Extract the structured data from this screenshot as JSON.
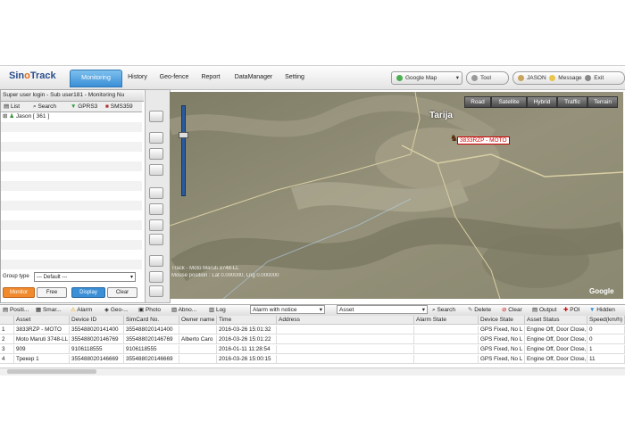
{
  "app": {
    "logo_left": "Sin",
    "logo_mid": "o",
    "logo_right": "Track"
  },
  "nav": {
    "tabs": [
      "Monitoring",
      "History",
      "Geo-fence",
      "Report",
      "DataManager",
      "Setting"
    ],
    "active": "Monitoring"
  },
  "topright": {
    "map_select": "Google Map",
    "tool": "Tool",
    "user": "JASON",
    "message": "Message",
    "exit": "Exit"
  },
  "left": {
    "header": "Super user login - Sub user181 - Monitoring Nu",
    "cmd": "cmd",
    "tabs": {
      "list": "List",
      "search": "Search",
      "gprs": "GPRS3",
      "sms": "SMS359"
    },
    "tree_item": "Jason [ 361 ]",
    "group_label": "Group type",
    "group_value": "--- Default ---",
    "buttons": {
      "monitor": "Monitor",
      "free": "Free",
      "display": "Display",
      "clear": "Clear"
    }
  },
  "map": {
    "types": [
      "Road",
      "Satellite",
      "Hybrid",
      "Traffic",
      "Terrain"
    ],
    "marker_label": "3833RZP - MOTO",
    "city_label": "Tarija",
    "footer_text": "Track - Moto Maruti 3748-LL",
    "footer_text2": "Mouse position : Lat 0.000000, Lng 0.000000",
    "google": "Google"
  },
  "bottom": {
    "tabs": [
      "Positi...",
      "Smar...",
      "Alarm",
      "Geo-...",
      "Photo",
      "Abno...",
      "Log"
    ],
    "alarm_filter": "Alarm with notice",
    "asset_filter": "Asset",
    "actions": {
      "search": "Search",
      "delete": "Delete",
      "clear": "Clear",
      "output": "Output",
      "poi": "POI",
      "hidden": "Hidden"
    }
  },
  "table": {
    "columns": [
      "Asset",
      "Device ID",
      "SimCard No.",
      "Owner name",
      "Time",
      "Address",
      "Alarm State",
      "Device State",
      "Asset Status",
      "Speed(km/h)"
    ],
    "rows": [
      {
        "n": "1",
        "asset": "3833RZP - MOTO",
        "device_id": "355488020141400",
        "sim": "355488020141400",
        "owner": "",
        "time": "2016-03-26 15:01:32",
        "address": "",
        "alarm": "",
        "device_state": "GPS Fixed, No L",
        "asset_status": "Engine Off, Door Close,",
        "speed": "0"
      },
      {
        "n": "2",
        "asset": "Moto Maruti 3748-LL",
        "device_id": "355488020146769",
        "sim": "355488020146769",
        "owner": "Alberto Caro",
        "time": "2016-03-26 15:01:22",
        "address": "",
        "alarm": "",
        "device_state": "GPS Fixed, No L",
        "asset_status": "Engine Off, Door Close,",
        "speed": "0"
      },
      {
        "n": "3",
        "asset": "909",
        "device_id": "9106118555",
        "sim": "9106118555",
        "owner": "",
        "time": "2016-01-11 11:28:54",
        "address": "",
        "alarm": "",
        "device_state": "GPS Fixed, No L",
        "asset_status": "Engine Off, Door Close,",
        "speed": "1"
      },
      {
        "n": "4",
        "asset": "Трекер 1",
        "device_id": "355488020146669",
        "sim": "355488020146669",
        "owner": "",
        "time": "2016-03-26 15:00:15",
        "address": "",
        "alarm": "",
        "device_state": "GPS Fixed, No L",
        "asset_status": "Engine Off, Door Close,",
        "speed": "11"
      }
    ]
  },
  "colors": {
    "accent": "#3a8fd6",
    "monitor_btn": "#f08a2c",
    "display_btn": "#3a8fd6",
    "map_bg": "#8d8970"
  }
}
